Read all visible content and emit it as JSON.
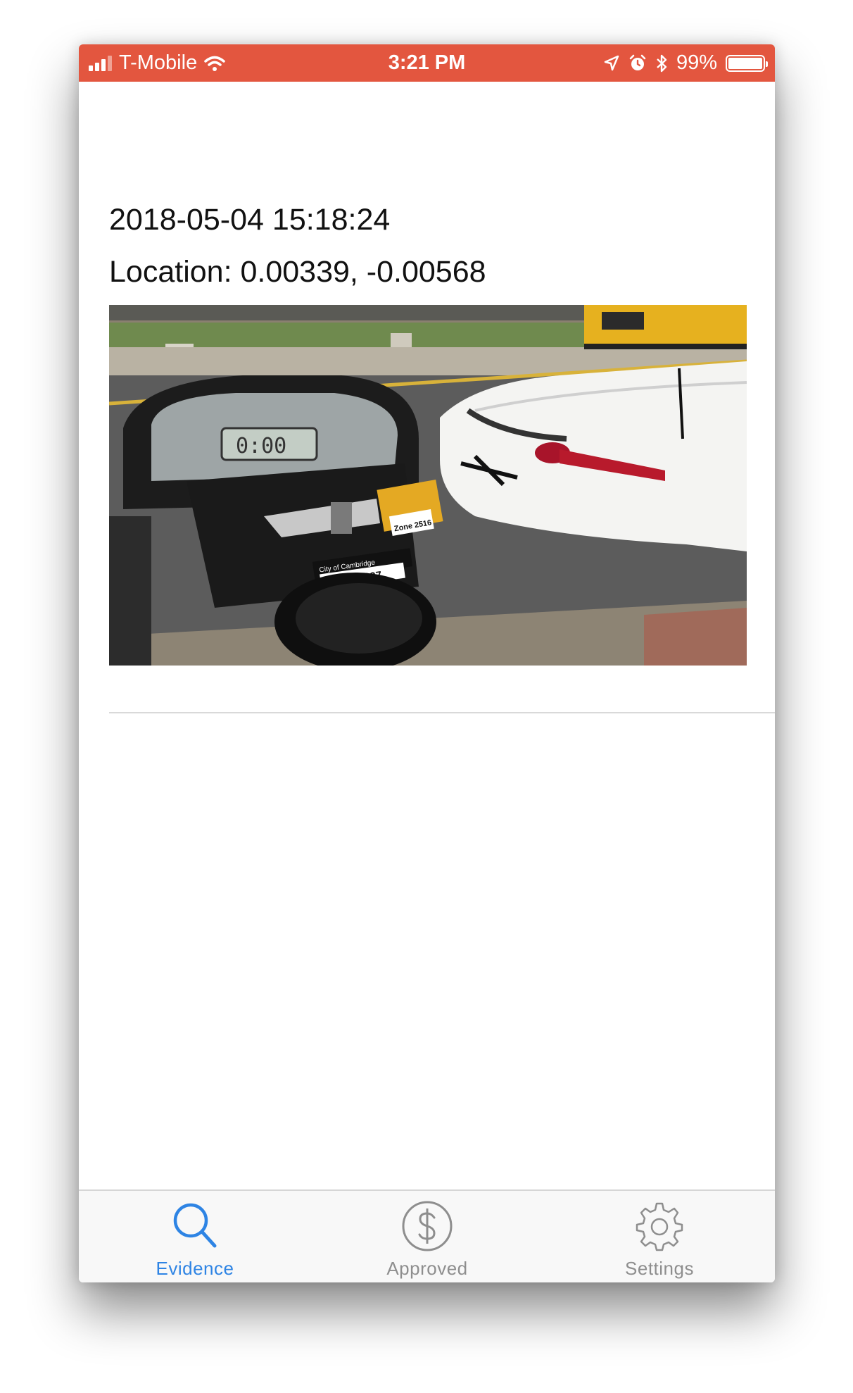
{
  "status_bar": {
    "carrier": "T-Mobile",
    "time": "3:21 PM",
    "battery": "99%",
    "icons": [
      "signal-icon",
      "wifi-icon",
      "location-arrow-icon",
      "alarm-icon",
      "bluetooth-icon",
      "battery-icon"
    ],
    "background": "#e3563f"
  },
  "evidence": {
    "timestamp": "2018-05-04 15:18:24",
    "location": "Location: 0.00339, -0.00568",
    "photo": {
      "subject": "parking-meter-and-white-car",
      "meter_sticker": "OXF-0037",
      "meter_city": "City of Cambridge",
      "meter_zone": "Zone 2516",
      "meter_display": "0:00"
    }
  },
  "tabbar": {
    "tabs": [
      {
        "label": "Evidence",
        "icon": "search-icon",
        "active": true
      },
      {
        "label": "Approved",
        "icon": "dollar-circle-icon",
        "active": false
      },
      {
        "label": "Settings",
        "icon": "gear-icon",
        "active": false
      }
    ],
    "active_color": "#2e84e4",
    "inactive_color": "#8e8e8e"
  }
}
